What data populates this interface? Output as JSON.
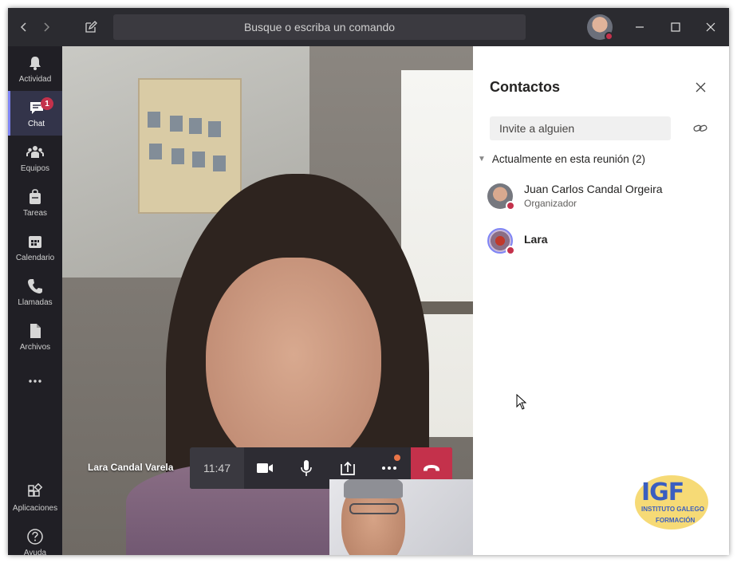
{
  "titlebar": {
    "search_placeholder": "Busque o escriba un comando",
    "back_icon": "chevron-left-icon",
    "forward_icon": "chevron-right-icon",
    "compose_icon": "compose-icon"
  },
  "rail": {
    "items": [
      {
        "label": "Actividad",
        "icon": "bell-icon"
      },
      {
        "label": "Chat",
        "icon": "chat-icon",
        "badge": "1",
        "active": true
      },
      {
        "label": "Equipos",
        "icon": "teams-icon"
      },
      {
        "label": "Tareas",
        "icon": "bag-icon"
      },
      {
        "label": "Calendario",
        "icon": "calendar-icon"
      },
      {
        "label": "Llamadas",
        "icon": "phone-icon"
      },
      {
        "label": "Archivos",
        "icon": "file-icon"
      },
      {
        "label": "",
        "icon": "more-icon"
      }
    ],
    "bottom_items": [
      {
        "label": "Aplicaciones",
        "icon": "apps-icon"
      },
      {
        "label": "Ayuda",
        "icon": "help-icon"
      }
    ]
  },
  "stage": {
    "participant_name": "Lara Candal Varela"
  },
  "callbar": {
    "time": "11:47"
  },
  "panel": {
    "title": "Contactos",
    "invite_placeholder": "Invite a alguien",
    "section_label": "Actualmente en esta reunión (2)",
    "people": [
      {
        "name": "Juan Carlos Candal Orgeira",
        "role": "Organizador"
      },
      {
        "name": "Lara",
        "role": ""
      }
    ]
  },
  "logo": {
    "big": "IGF",
    "line1": "INSTITUTO GALEGO",
    "line2": "FORMACIÓN"
  },
  "colors": {
    "accent": "#7f85f5",
    "status_busy": "#c4314b",
    "hangup": "#c4314b"
  }
}
